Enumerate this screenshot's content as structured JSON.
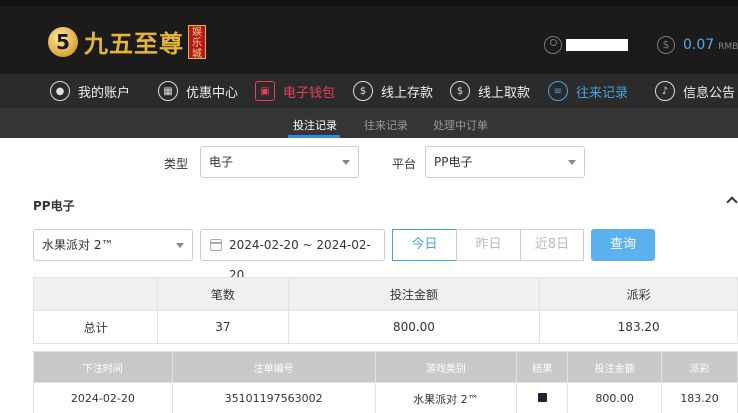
{
  "header": {
    "brand": "九五至尊",
    "brand_badge": "娱乐城",
    "balance_value": "0.07",
    "balance_unit": "RMB"
  },
  "nav": [
    {
      "label": "我的账户",
      "icon": "user-icon"
    },
    {
      "label": "优惠中心",
      "icon": "gift-icon"
    },
    {
      "label": "电子钱包",
      "icon": "wallet-icon"
    },
    {
      "label": "线上存款",
      "icon": "deposit-icon"
    },
    {
      "label": "线上取款",
      "icon": "withdraw-icon"
    },
    {
      "label": "往来记录",
      "icon": "records-icon"
    },
    {
      "label": "信息公告",
      "icon": "bell-icon"
    }
  ],
  "subnav": [
    "投注记录",
    "往来记录",
    "处理中订单"
  ],
  "filters": {
    "type_label": "类型",
    "type_value": "电子",
    "platform_label": "平台",
    "platform_value": "PP电子",
    "section_title": "PP电子",
    "game_value": "水果派对 2™",
    "date_range": "2024-02-20 ~ 2024-02-20",
    "today": "今日",
    "yesterday": "昨日",
    "last8": "近8日",
    "query": "查询"
  },
  "summary": {
    "headers": [
      "",
      "笔数",
      "投注金额",
      "派彩"
    ],
    "row": [
      "总计",
      "37",
      "800.00",
      "183.20"
    ]
  },
  "details": {
    "headers": [
      "下注时间",
      "注单编号",
      "游戏类别",
      "结果",
      "投注金额",
      "派彩"
    ],
    "rows": [
      [
        "2024-02-20",
        "35101197563002",
        "水果派对 2™",
        "",
        "800.00",
        "183.20"
      ]
    ]
  },
  "colors": {
    "accent_blue": "#4aa3e0",
    "active_red": "#e8405a",
    "gold": "#e3b53a"
  }
}
